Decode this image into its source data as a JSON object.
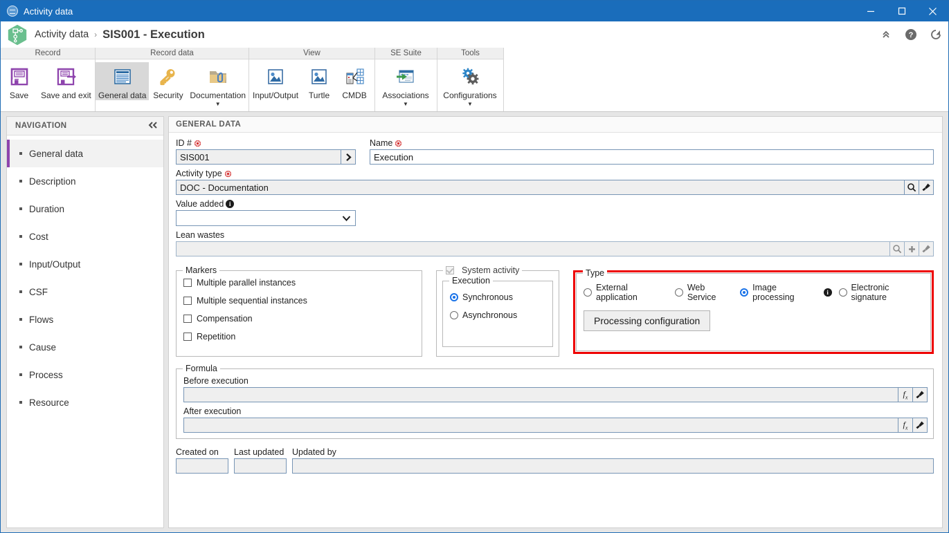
{
  "window": {
    "title": "Activity data",
    "icon": "globe-icon",
    "minimize_label": "–",
    "maximize_label": "□",
    "close_label": "✕"
  },
  "header": {
    "logo": "process-hexagon-logo",
    "breadcrumb_parent": "Activity data",
    "breadcrumb_separator": "›",
    "breadcrumb_current": "SIS001 - Execution",
    "tools": [
      {
        "name": "collapse-ribbon-icon",
        "glyph": "chevrons-up"
      },
      {
        "name": "help-icon",
        "glyph": "question-circle"
      },
      {
        "name": "refresh-icon",
        "glyph": "refresh"
      }
    ]
  },
  "ribbon": {
    "groups": [
      {
        "title": "Record",
        "buttons": [
          {
            "label": "Save",
            "icon": "save-icon",
            "active": false,
            "caret": false
          },
          {
            "label": "Save and exit",
            "icon": "save-and-exit-icon",
            "active": false,
            "caret": false
          }
        ]
      },
      {
        "title": "Record data",
        "buttons": [
          {
            "label": "General data",
            "icon": "general-data-icon",
            "active": true,
            "caret": false
          },
          {
            "label": "Security",
            "icon": "key-icon",
            "active": false,
            "caret": false
          },
          {
            "label": "Documentation",
            "icon": "folder-attachment-icon",
            "active": false,
            "caret": true
          }
        ]
      },
      {
        "title": "View",
        "buttons": [
          {
            "label": "Input/Output",
            "icon": "image-icon",
            "active": false,
            "caret": false
          },
          {
            "label": "Turtle",
            "icon": "image-icon",
            "active": false,
            "caret": false
          },
          {
            "label": "CMDB",
            "icon": "cmdb-icon",
            "active": false,
            "caret": false
          }
        ]
      },
      {
        "title": "SE Suite",
        "buttons": [
          {
            "label": "Associations",
            "icon": "associations-icon",
            "active": false,
            "caret": true
          }
        ]
      },
      {
        "title": "Tools",
        "buttons": [
          {
            "label": "Configurations",
            "icon": "gears-icon",
            "active": false,
            "caret": true
          }
        ]
      }
    ]
  },
  "navigation": {
    "title": "NAVIGATION",
    "collapse_icon": "chevrons-left-icon",
    "items": [
      {
        "label": "General data",
        "selected": true
      },
      {
        "label": "Description",
        "selected": false
      },
      {
        "label": "Duration",
        "selected": false
      },
      {
        "label": "Cost",
        "selected": false
      },
      {
        "label": "Input/Output",
        "selected": false
      },
      {
        "label": "CSF",
        "selected": false
      },
      {
        "label": "Flows",
        "selected": false
      },
      {
        "label": "Cause",
        "selected": false
      },
      {
        "label": "Process",
        "selected": false
      },
      {
        "label": "Resource",
        "selected": false
      }
    ]
  },
  "general_data": {
    "section_title": "GENERAL DATA",
    "id_label": "ID #",
    "id_value": "SIS001",
    "id_go_icon": "chevron-right-icon",
    "name_label": "Name",
    "name_value": "Execution",
    "activity_type_label": "Activity type",
    "activity_type_value": "DOC - Documentation",
    "activity_type_search_icon": "magnifier-icon",
    "activity_type_clear_icon": "brush-icon",
    "value_added_label": "Value added",
    "value_added_value": "",
    "value_added_info_icon": "info-icon",
    "lean_wastes_label": "Lean wastes",
    "lean_wastes_value": "",
    "lean_wastes_search_icon": "magnifier-icon",
    "lean_wastes_add_icon": "plus-icon",
    "lean_wastes_clear_icon": "brush-icon"
  },
  "markers": {
    "legend": "Markers",
    "items": [
      {
        "label": "Multiple parallel instances",
        "checked": false
      },
      {
        "label": "Multiple sequential instances",
        "checked": false
      },
      {
        "label": "Compensation",
        "checked": false
      },
      {
        "label": "Repetition",
        "checked": false
      }
    ]
  },
  "system_activity": {
    "legend": "System activity",
    "checked": true,
    "disabled": true,
    "execution": {
      "legend": "Execution",
      "options": [
        {
          "label": "Synchronous",
          "selected": true
        },
        {
          "label": "Asynchronous",
          "selected": false
        }
      ]
    }
  },
  "type_section": {
    "legend": "Type",
    "highlight_color": "#ee0000",
    "options": [
      {
        "label": "External application",
        "selected": false,
        "info": false
      },
      {
        "label": "Web Service",
        "selected": false,
        "info": false
      },
      {
        "label": "Image processing",
        "selected": true,
        "info": true
      },
      {
        "label": "Electronic signature",
        "selected": false,
        "info": false
      }
    ],
    "info_icon": "info-icon",
    "button_label": "Processing configuration"
  },
  "formula": {
    "legend": "Formula",
    "before_label": "Before execution",
    "before_value": "",
    "after_label": "After execution",
    "after_value": "",
    "fx_icon": "fx-icon",
    "clear_icon": "brush-icon"
  },
  "audit": {
    "created_on_label": "Created on",
    "created_on_value": "",
    "last_updated_label": "Last updated",
    "last_updated_value": "",
    "updated_by_label": "Updated by",
    "updated_by_value": ""
  }
}
